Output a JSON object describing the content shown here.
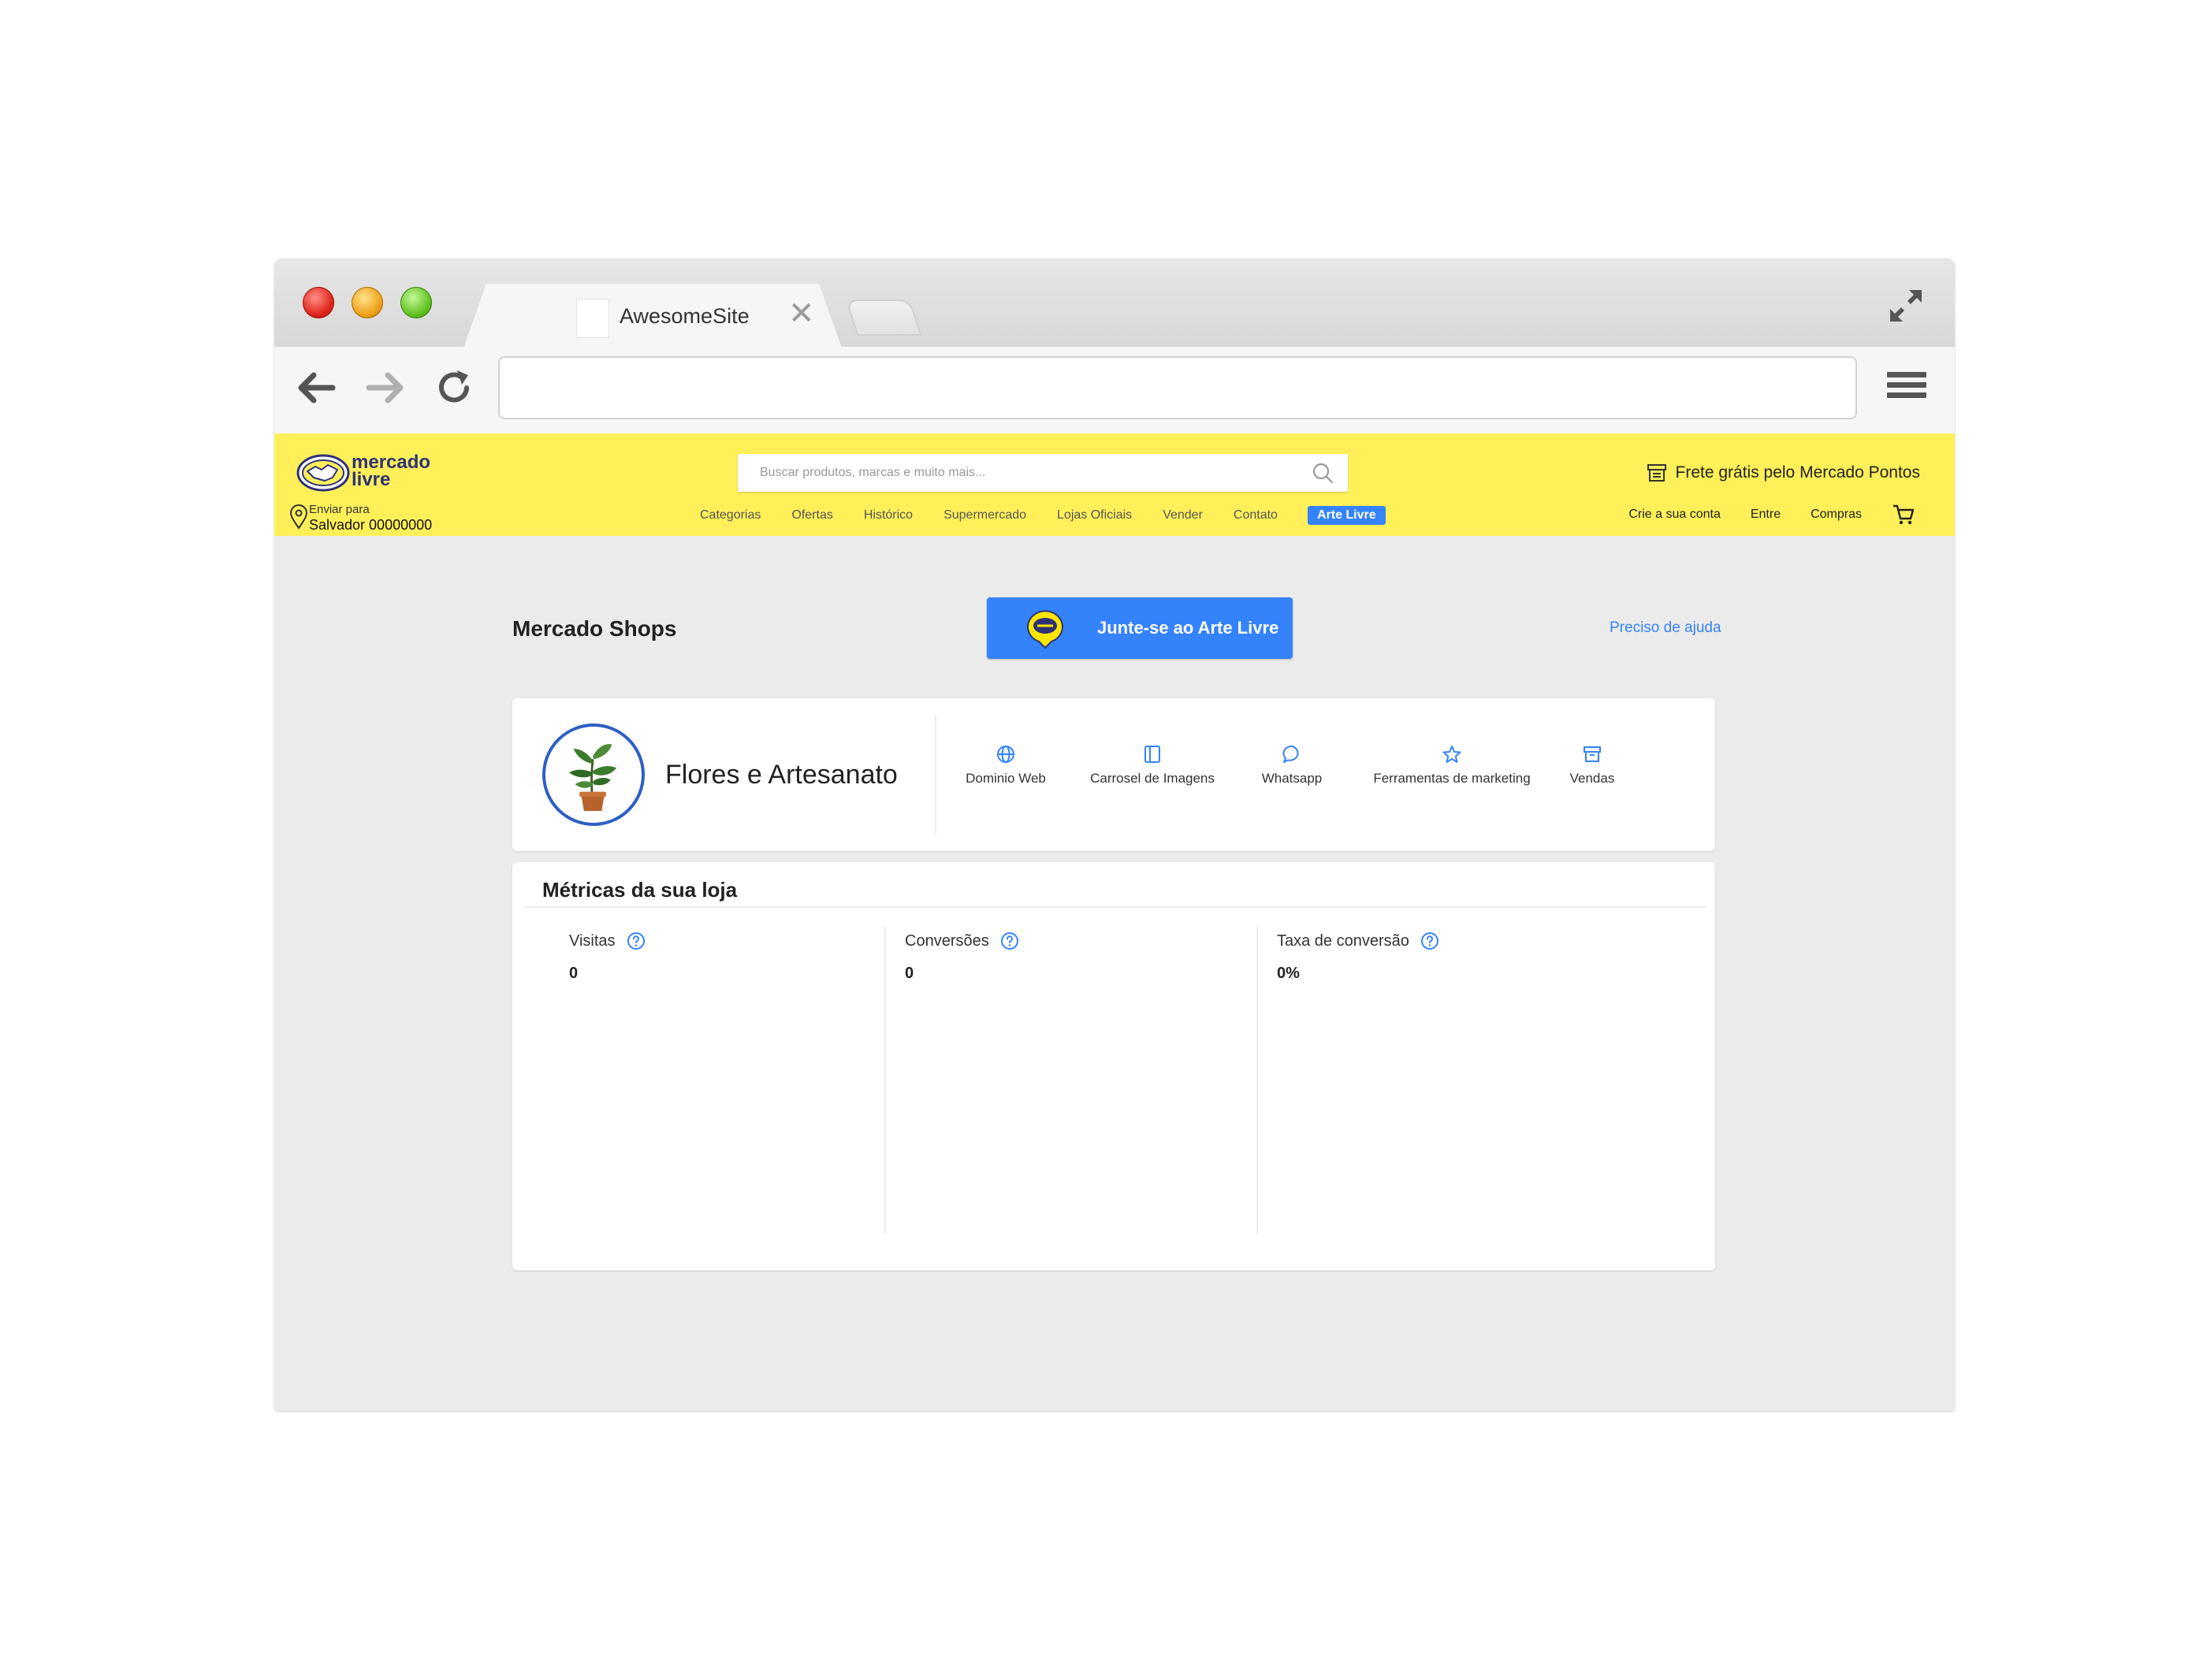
{
  "browser": {
    "tab_title": "AwesomeSite",
    "tab_close": "✕",
    "address": ""
  },
  "header": {
    "logo_text_line1": "mercado",
    "logo_text_line2": "livre",
    "ship_label": "Enviar para",
    "ship_address": "Salvador 00000000",
    "search_placeholder": "Buscar produtos, marcas e muito mais...",
    "promo": "Frete grátis pelo Mercado Pontos",
    "nav": [
      "Categorias",
      "Ofertas",
      "Histórico",
      "Supermercado",
      "Lojas Oficiais",
      "Vender",
      "Contato",
      "Arte Livre"
    ],
    "right_links": [
      "Crie a sua conta",
      "Entre",
      "Compras"
    ],
    "brand_color": "#fff059",
    "accent_color": "#3483fa"
  },
  "main": {
    "title": "Mercado Shops",
    "join_button": "Junte-se ao Arte Livre",
    "help_link": "Preciso de ajuda"
  },
  "store": {
    "name": "Flores e Artesanato",
    "tools": [
      {
        "label": "Dominio Web",
        "icon": "globe-icon"
      },
      {
        "label": "Carrosel de Imagens",
        "icon": "carousel-icon"
      },
      {
        "label": "Whatsapp",
        "icon": "chat-bubble-icon"
      },
      {
        "label": "Ferramentas de marketing",
        "icon": "star-icon"
      },
      {
        "label": "Vendas",
        "icon": "archive-box-icon"
      }
    ]
  },
  "metrics": {
    "title": "Métricas da sua loja",
    "items": [
      {
        "label": "Visitas",
        "value": "0"
      },
      {
        "label": "Conversões",
        "value": "0"
      },
      {
        "label": "Taxa de conversão",
        "value": "0%"
      }
    ]
  }
}
